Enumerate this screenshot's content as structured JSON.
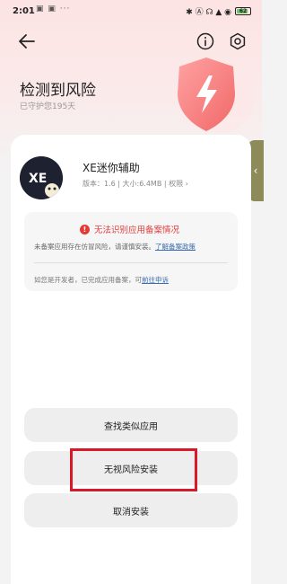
{
  "status_bar": {
    "time": "2:01",
    "extra_icons": "▣ ▣ ···",
    "right_icons": "✱ Ⓐ ☊ ▲ ◉",
    "battery": "62"
  },
  "header": {
    "title": "检测到风险",
    "subtitle": "已守护您195天"
  },
  "app": {
    "name": "XE迷你辅助",
    "meta": "版本：1.6 | 大小:6.4MB | 权限 ›",
    "icon_text": "XE"
  },
  "warning": {
    "title": "无法识别应用备案情况",
    "text": "未备案应用存在仿冒风险，请谨慎安装。",
    "policy_link": "了解备案政策",
    "dev_text": "如您是开发者，已完成应用备案，可",
    "appeal_link": "前往申诉"
  },
  "buttons": {
    "find_similar": "查找类似应用",
    "ignore_install": "无视风险安装",
    "cancel_install": "取消安装"
  },
  "colors": {
    "accent_red": "#e53935",
    "link_blue": "#3b6db0",
    "highlight_red": "#d9182a"
  }
}
